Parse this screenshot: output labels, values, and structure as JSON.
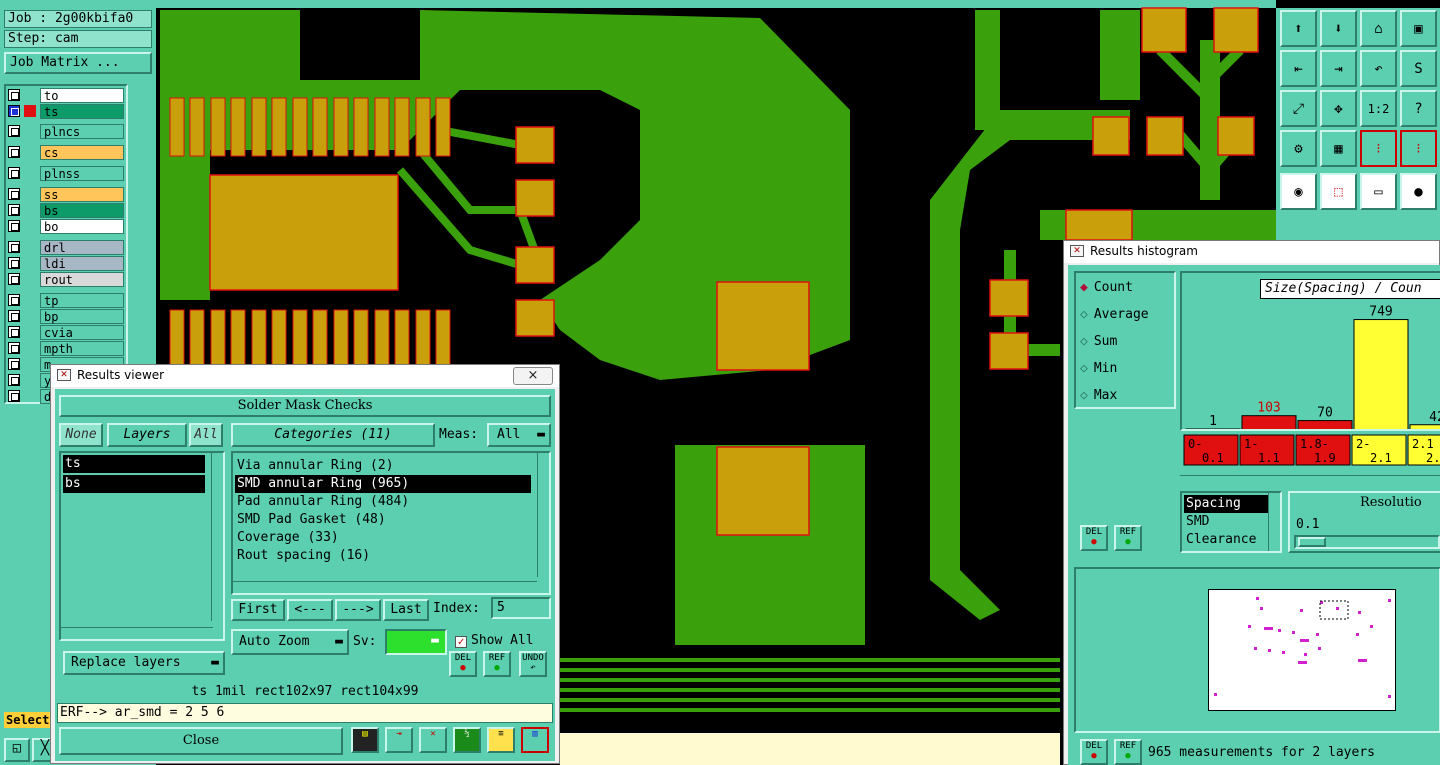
{
  "job": {
    "job_label": "Job : 2g00kbifa0",
    "step_label": "Step: cam",
    "matrix_button": "Job Matrix ..."
  },
  "layers": [
    {
      "name": "to",
      "color": "#ffffff",
      "active": false
    },
    {
      "name": "ts",
      "color": "#0d9b6a",
      "active": true
    },
    {
      "name": "plncs",
      "color": "#5ccfb0",
      "active": false
    },
    {
      "name": "cs",
      "color": "#ffc45a",
      "active": false
    },
    {
      "name": "plnss",
      "color": "#5ccfb0",
      "active": false
    },
    {
      "name": "ss",
      "color": "#ffc45a",
      "active": false
    },
    {
      "name": "bs",
      "color": "#0d9b6a",
      "active": false
    },
    {
      "name": "bo",
      "color": "#ffffff",
      "active": false
    },
    {
      "name": "drl",
      "color": "#a7b7c5",
      "active": false
    },
    {
      "name": "ldi",
      "color": "#a7b7c5",
      "active": false
    },
    {
      "name": "rout",
      "color": "#d9d9d9",
      "active": false
    },
    {
      "name": "tp",
      "color": "#5ccfb0",
      "active": false
    },
    {
      "name": "bp",
      "color": "#5ccfb0",
      "active": false
    },
    {
      "name": "cvia",
      "color": "#5ccfb0",
      "active": false
    },
    {
      "name": "mpth",
      "color": "#5ccfb0",
      "active": false
    },
    {
      "name": "m",
      "color": "#5ccfb0",
      "active": false
    },
    {
      "name": "y",
      "color": "#5ccfb0",
      "active": false
    },
    {
      "name": "d",
      "color": "#5ccfb0",
      "active": false
    }
  ],
  "select_label": "Select",
  "results_viewer": {
    "title": "Results viewer",
    "close_x": "×",
    "header": "Solder Mask Checks",
    "none_btn": "None",
    "layers_btn": "Layers",
    "all_btn": "All",
    "categories_btn": "Categories (11)",
    "meas_label": "Meas:",
    "meas_value": "All",
    "layers_list": [
      "ts",
      "bs"
    ],
    "categories": [
      {
        "label": "Via annular Ring (2)",
        "selected": false
      },
      {
        "label": "SMD annular Ring (965)",
        "selected": true
      },
      {
        "label": "Pad annular Ring (484)",
        "selected": false
      },
      {
        "label": "SMD Pad Gasket (48)",
        "selected": false
      },
      {
        "label": "Coverage (33)",
        "selected": false
      },
      {
        "label": "Rout spacing (16)",
        "selected": false
      }
    ],
    "first_btn": "First",
    "prev_btn": "<---",
    "next_btn": "--->",
    "last_btn": "Last",
    "index_label": "Index:",
    "index_value": "5",
    "auto_zoom": "Auto Zoom",
    "sv_label": "Sv:",
    "show_all": "Show All",
    "replace_layers": "Replace layers",
    "del": "DEL",
    "ref": "REF",
    "undo": "UNDO",
    "status_line": "ts 1mil  rect102x97  rect104x99",
    "erf_line": "ERF--> ar_smd = 2 5 6",
    "close_btn": "Close"
  },
  "histogram": {
    "title": "Results histogram",
    "modes": [
      {
        "label": "Count",
        "selected": true
      },
      {
        "label": "Average",
        "selected": false
      },
      {
        "label": "Sum",
        "selected": false
      },
      {
        "label": "Min",
        "selected": false
      },
      {
        "label": "Max",
        "selected": false
      }
    ],
    "chart_title": "Size(Spacing) / Coun",
    "resolution_label": "Resolutio",
    "resolution_value": "0.1",
    "measures": [
      {
        "label": "Spacing",
        "selected": true
      },
      {
        "label": "SMD",
        "selected": false
      },
      {
        "label": "Clearance",
        "selected": false
      }
    ],
    "del": "DEL",
    "ref": "REF",
    "summary": "965 measurements for 2 layers"
  },
  "chart_data": {
    "type": "bar",
    "title": "Size(Spacing) / Coun",
    "xlabel": "Spacing",
    "ylabel": "Count",
    "categories": [
      "0-\n0.1",
      "1-\n1.1",
      "1.8-\n1.9",
      "2-\n2.1",
      "2.1\n2."
    ],
    "values": [
      1,
      103,
      70,
      749,
      42
    ],
    "bar_colors": [
      "#e01010",
      "#e01010",
      "#e01010",
      "#ffff33",
      "#ffff33"
    ],
    "label_colors": [
      "#000000",
      "#cc0000",
      "#000000",
      "#000000",
      "#000000"
    ],
    "ylim": [
      0,
      820
    ],
    "grid": false
  }
}
